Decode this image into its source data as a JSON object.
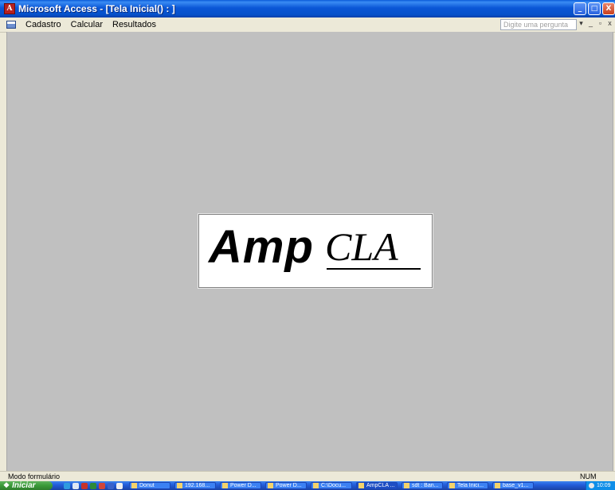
{
  "window": {
    "title": "Microsoft Access - [Tela Inicial() : ]",
    "app_icon_letter": "A",
    "controls": {
      "minimize": "_",
      "maximize": "□",
      "close": "X"
    }
  },
  "menubar": {
    "items": [
      {
        "label": "Cadastro"
      },
      {
        "label": "Calcular"
      },
      {
        "label": "Resultados"
      }
    ],
    "ask_placeholder": "Digite uma pergunta",
    "mdi_controls": {
      "dropdown": "▾",
      "minimize": "_",
      "restore": "▫",
      "close": "x"
    }
  },
  "logo": {
    "part1": "Amp",
    "part2": "CLA"
  },
  "statusbar": {
    "mode": "Modo formulário",
    "num": "NUM"
  },
  "taskbar": {
    "start_label": "Iniciar",
    "buttons": [
      {
        "label": "Donut"
      },
      {
        "label": "192.168..."
      },
      {
        "label": "Power D..."
      },
      {
        "label": "Power D..."
      },
      {
        "label": "C:\\Docu..."
      },
      {
        "label": "AmpCLA ..."
      },
      {
        "label": "sdt : Ban..."
      },
      {
        "label": "Tela Inici..."
      },
      {
        "label": "base_v1..."
      }
    ],
    "clock": "10:09"
  },
  "colors": {
    "titlebar": "#0a56d6",
    "client_bg": "#c0c0c0",
    "chrome": "#ece9d8",
    "start_green": "#3a9a38"
  }
}
